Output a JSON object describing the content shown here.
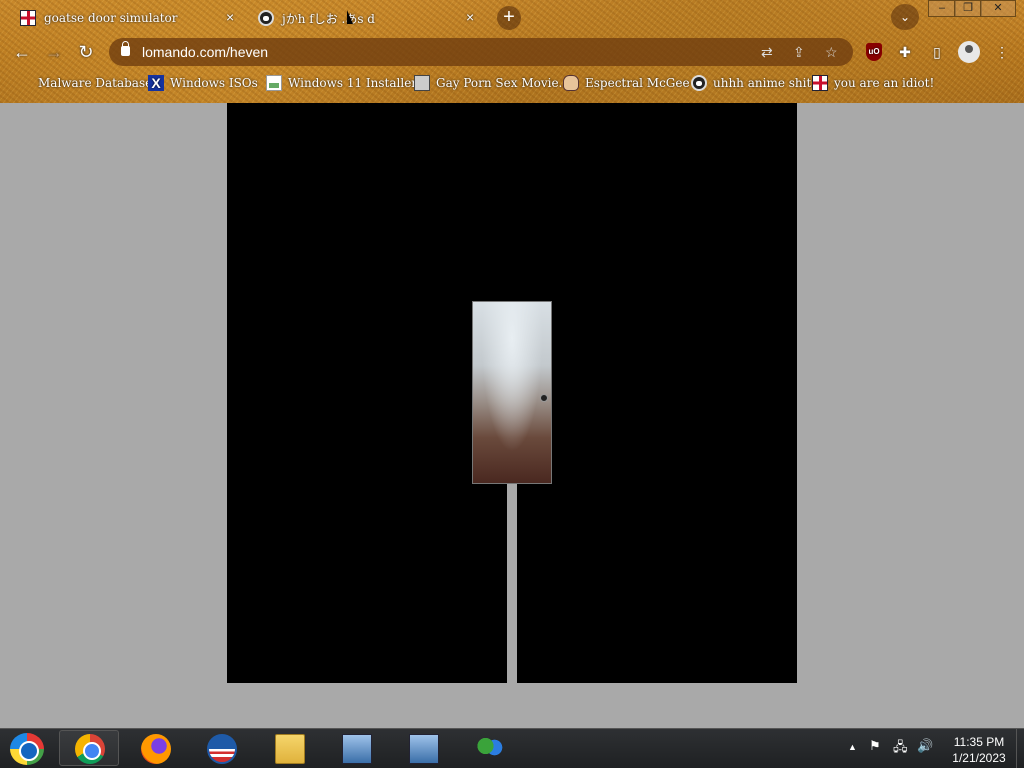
{
  "browser": {
    "tabs": [
      {
        "title": "goatse door simulator",
        "icon": "flag-icon",
        "active": true
      },
      {
        "title": "jかh fしお .あs d",
        "icon": "anime-face-icon",
        "active": false
      }
    ],
    "tab_close_glyph": "×",
    "new_tab_glyph": "+",
    "tab_search_glyph": "⌄",
    "window_controls": {
      "minimize": "–",
      "restore": "❐",
      "close": "✕"
    },
    "nav": {
      "back": "←",
      "forward": "→",
      "reload": "↻"
    },
    "url": "lomando.com/heven",
    "omnibox_icons": {
      "translate": "⇄",
      "share": "⇪",
      "bookmark": "☆"
    },
    "toolbar": {
      "extension_ublock": "uO",
      "extensions": "✚",
      "side_panel": "▯",
      "menu": "⋮"
    }
  },
  "bookmarks": [
    {
      "label": "Malware Database",
      "icon": "wheat-icon"
    },
    {
      "label": "Windows ISOs",
      "icon": "x-icon",
      "glyph": "X"
    },
    {
      "label": "Windows 11 Installer",
      "icon": "page-icon"
    },
    {
      "label": "Gay Porn Sex Movie...",
      "icon": "computer-icon"
    },
    {
      "label": "Espectral McGee",
      "icon": "man-icon"
    },
    {
      "label": "uhhh anime shit",
      "icon": "anime-face-icon"
    },
    {
      "label": "you are an idiot!",
      "icon": "flag-icon"
    }
  ],
  "page": {
    "background": "#a9a9a9",
    "scene_color": "#000000",
    "door_description": "door-icon"
  },
  "taskbar": {
    "items": [
      "start-orb",
      "chrome",
      "firefox",
      "obama",
      "file-explorer",
      "installer",
      "installer",
      "people"
    ],
    "tray": {
      "show_hidden": "▲",
      "flag": "⚑",
      "network": "🖧",
      "volume": "🔊"
    },
    "time": "11:35 PM",
    "date": "1/21/2023"
  }
}
